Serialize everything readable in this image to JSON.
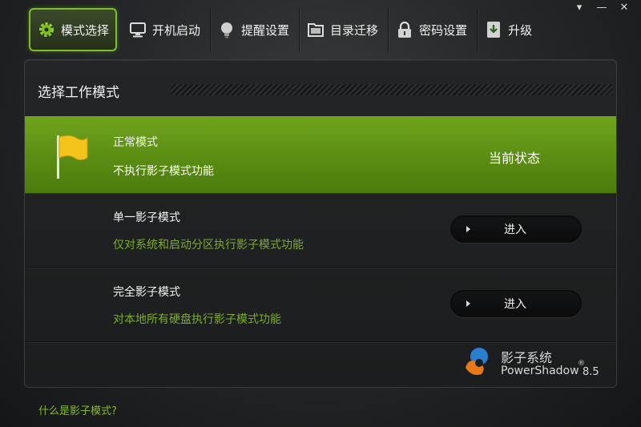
{
  "window": {
    "controls": [
      "▾",
      "—",
      "✕"
    ]
  },
  "toolbar": {
    "tabs": [
      {
        "label": "模式选择",
        "icon": "gear-icon"
      },
      {
        "label": "开机启动",
        "icon": "monitor-icon"
      },
      {
        "label": "提醒设置",
        "icon": "bulb-icon"
      },
      {
        "label": "目录迁移",
        "icon": "folder-icon"
      },
      {
        "label": "密码设置",
        "icon": "lock-icon"
      },
      {
        "label": "升级",
        "icon": "upgrade-icon"
      }
    ]
  },
  "panel": {
    "title": "选择工作模式",
    "modes": [
      {
        "name": "正常模式",
        "description": "不执行影子模式功能",
        "state": "当前状态",
        "icon": "flag-icon"
      },
      {
        "name": "单一影子模式",
        "description": "仅对系统和启动分区执行影子模式功能",
        "button": "进入"
      },
      {
        "name": "完全影子模式",
        "description": "对本地所有硬盘执行影子模式功能",
        "button": "进入"
      }
    ]
  },
  "brand": {
    "cn": "影子系统",
    "en": "PowerShadow",
    "reg": "®",
    "version": "8.5"
  },
  "help": {
    "link": "什么是影子模式?"
  },
  "colors": {
    "accent": "#6fa41c",
    "link": "#86b82b",
    "desc": "#7dab2a"
  }
}
